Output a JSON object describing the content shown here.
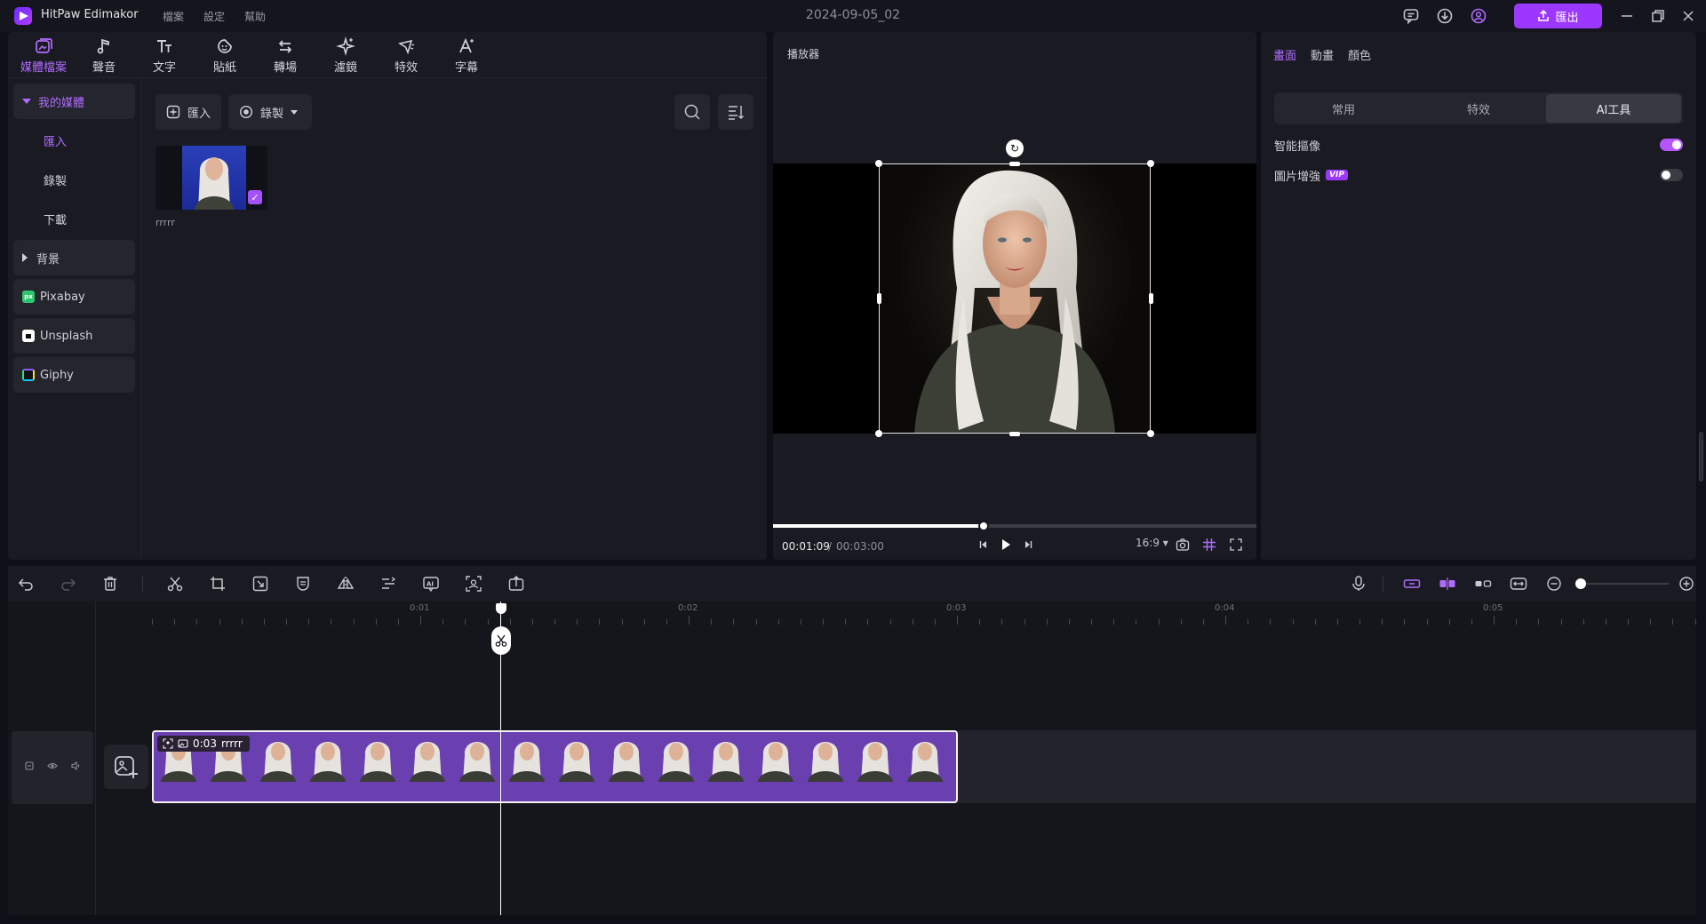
{
  "titlebar": {
    "app_name": "HitPaw Edimakor",
    "menu": [
      "檔案",
      "設定",
      "幫助"
    ],
    "project_title": "2024-09-05_02",
    "export_label": "匯出"
  },
  "tool_tabs": [
    {
      "label": "媒體檔案",
      "icon": "media-icon",
      "active": true
    },
    {
      "label": "聲音",
      "icon": "music-note-icon"
    },
    {
      "label": "文字",
      "icon": "text-icon"
    },
    {
      "label": "貼紙",
      "icon": "sticker-icon"
    },
    {
      "label": "轉場",
      "icon": "transition-icon"
    },
    {
      "label": "濾鏡",
      "icon": "filter-sparkle-icon"
    },
    {
      "label": "特效",
      "icon": "effects-icon"
    },
    {
      "label": "字幕",
      "icon": "subtitle-icon"
    }
  ],
  "side_nav": {
    "my_media": "我的媒體",
    "import": "匯入",
    "record": "錄製",
    "download": "下載",
    "background": "背景",
    "pixabay": "Pixabay",
    "unsplash": "Unsplash",
    "giphy": "Giphy"
  },
  "media_toolbar": {
    "import_label": "匯入",
    "record_label": "錄製"
  },
  "media_item": {
    "name": "rrrrr"
  },
  "player": {
    "title": "播放器",
    "current_time": "00:01:09",
    "separator": "/",
    "total_time": "00:03:00",
    "progress": 0.435,
    "aspect_ratio": "16:9"
  },
  "props": {
    "tabs": [
      "畫面",
      "動畫",
      "顏色"
    ],
    "sub_tabs": [
      "常用",
      "特效",
      "AI工具"
    ],
    "smart_cutout_label": "智能摳像",
    "smart_cutout_on": true,
    "image_enhance_label": "圖片增強",
    "image_enhance_badge": "VIP",
    "image_enhance_on": false
  },
  "timeline": {
    "ruler_labels": [
      "0:01",
      "0:02",
      "0:03",
      "0:04",
      "0:05"
    ],
    "clip_duration": "0:03",
    "clip_name": "rrrrr",
    "zoom_level": 0.0
  },
  "colors": {
    "accent": "#9b37ff",
    "accent_text": "#b06cff",
    "clip_fill": "#6a3fb0",
    "panel_bg": "#1a1b22",
    "app_bg": "#0f1017"
  }
}
